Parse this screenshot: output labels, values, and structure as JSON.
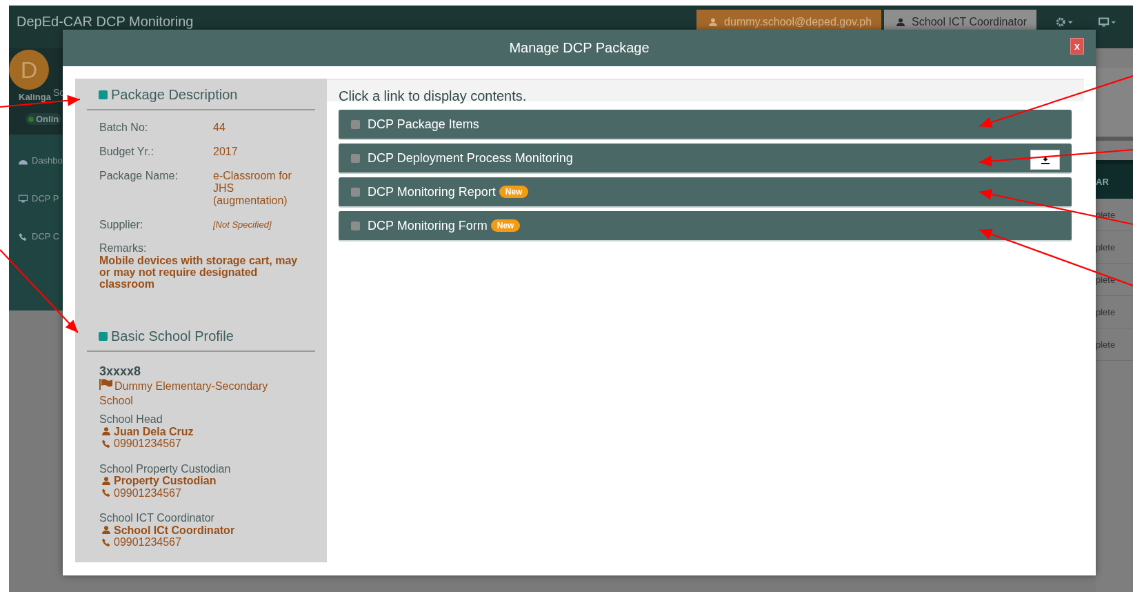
{
  "app": {
    "title": "DepEd-CAR DCP Monitoring",
    "user_email": "dummy.school@deped.gov.ph",
    "role": "School ICT Coordinator"
  },
  "sidebar": {
    "avatar": "D",
    "profile_text": "Sc",
    "location": "Kalinga",
    "status": "Onlin",
    "items": [
      {
        "label": "Dashbo",
        "kind": "dashboard"
      },
      {
        "label": "DCP P",
        "kind": "monitor"
      },
      {
        "label": "DCP C",
        "kind": "phone"
      }
    ]
  },
  "table": {
    "column": "AR",
    "cells": [
      "plete",
      "plete",
      "plete",
      "plete",
      "plete"
    ]
  },
  "modal": {
    "title": "Manage DCP Package",
    "close": "x",
    "package_description": {
      "heading": "Package Description",
      "fields": [
        {
          "label": "Batch No:",
          "value": "44",
          "kind": "text"
        },
        {
          "label": "Budget Yr.:",
          "value": "2017",
          "kind": "text"
        },
        {
          "label": "Package Name:",
          "value": "e-Classroom for JHS (augmentation)",
          "kind": "text"
        },
        {
          "label": "Supplier:",
          "value": "[Not Specified]",
          "kind": "unspecified"
        }
      ],
      "remarks_label": "Remarks:",
      "remarks": "Mobile devices with storage cart, may or may not require designated classroom"
    },
    "school_profile": {
      "heading": "Basic School Profile",
      "code": "3xxxx8",
      "school_name": "Dummy Elementary-Secondary School",
      "contacts": [
        {
          "role": "School Head",
          "name": "Juan Dela Cruz",
          "phone": "09901234567"
        },
        {
          "role": "School Property Custodian",
          "name": "Property Custodian",
          "phone": "09901234567"
        },
        {
          "role": "School ICT Coordinator",
          "name": "School ICt Coordinator",
          "phone": "09901234567"
        }
      ]
    },
    "hint": "Click a link to display contents.",
    "links": [
      {
        "label": "DCP Package Items",
        "download": false
      },
      {
        "label": "DCP Deployment Process Monitoring",
        "download": true
      },
      {
        "label": "DCP Monitoring Report",
        "badge": "New",
        "download": false
      },
      {
        "label": "DCP Monitoring Form",
        "badge": "New",
        "download": false
      }
    ]
  }
}
